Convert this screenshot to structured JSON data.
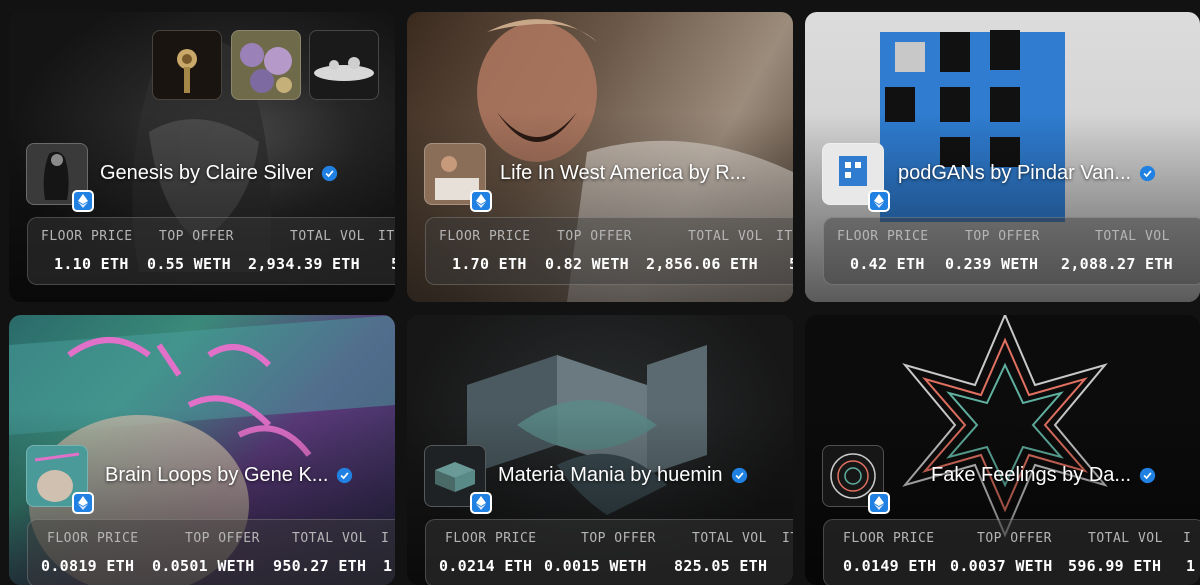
{
  "stat_labels": {
    "floor": "FLOOR PRICE",
    "offer": "TOP OFFER",
    "vol": "TOTAL VOL",
    "items_partial": "IT",
    "items_partial_short": "I"
  },
  "collections": [
    {
      "name": "Genesis by Claire Silver",
      "floor": "1.10 ETH",
      "offer": "0.55 WETH",
      "vol": "2,934.39 ETH",
      "items_partial": "5",
      "verified": true
    },
    {
      "name": "Life In West America by R...",
      "floor": "1.70 ETH",
      "offer": "0.82 WETH",
      "vol": "2,856.06 ETH",
      "items_partial": "5",
      "verified": false
    },
    {
      "name": "podGANs by Pindar Van...",
      "floor": "0.42 ETH",
      "offer": "0.239 WETH",
      "vol": "2,088.27 ETH",
      "items_partial": "",
      "verified": true
    },
    {
      "name": "Brain Loops by Gene K...",
      "floor": "0.0819 ETH",
      "offer": "0.0501 WETH",
      "vol": "950.27 ETH",
      "items_partial": "1",
      "verified": true
    },
    {
      "name": "Materia Mania by huemin",
      "floor": "0.0214 ETH",
      "offer": "0.0015 WETH",
      "vol": "825.05 ETH",
      "items_partial": "",
      "verified": true
    },
    {
      "name": "Fake Feelings by Da...",
      "floor": "0.0149 ETH",
      "offer": "0.0037 WETH",
      "vol": "596.99 ETH",
      "items_partial": "1",
      "verified": true
    }
  ],
  "icons": {
    "chain": "ethereum-icon",
    "verified": "verified-badge-icon"
  },
  "colors": {
    "verified": "#2081e2",
    "background": "#121212"
  }
}
